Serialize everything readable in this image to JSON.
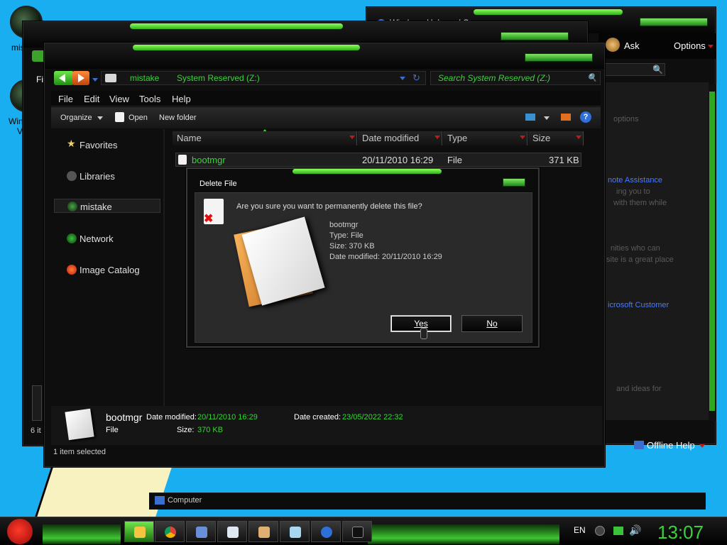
{
  "desktop": {
    "icons": [
      {
        "label": "mis"
      },
      {
        "label": "Win"
      },
      {
        "label": "V"
      }
    ]
  },
  "help_window": {
    "title": "Windows Help and Support",
    "ask_label": "Ask",
    "options_label": "Options",
    "text_lines": [
      "options",
      "note Assistance",
      "ing you to",
      "with them while",
      "nities who can",
      "site is a great place",
      "icrosoft Customer",
      "and ideas for"
    ],
    "offline_help_label": "Offline Help",
    "status_label": "Computer"
  },
  "explorer": {
    "back_window_label": "Fi",
    "back_status_label": "6 it",
    "breadcrumb": {
      "part1": "mistake",
      "part2": "System Reserved (Z:)"
    },
    "search_placeholder": "Search System Reserved (Z:)",
    "menu": {
      "file": "File",
      "edit": "Edit",
      "view": "View",
      "tools": "Tools",
      "help": "Help"
    },
    "toolbar": {
      "organize": "Organize",
      "open": "Open",
      "new_folder": "New folder"
    },
    "nav": {
      "favorites": "Favorites",
      "libraries": "Libraries",
      "mistake": "mistake",
      "network": "Network",
      "image_catalog": "Image Catalog"
    },
    "columns": {
      "name": "Name",
      "date_modified": "Date modified",
      "type": "Type",
      "size": "Size"
    },
    "file": {
      "name": "bootmgr",
      "date": "20/11/2010 16:29",
      "type": "File",
      "size": "371 KB"
    },
    "details": {
      "name": "bootmgr",
      "type": "File",
      "date_modified_label": "Date modified:",
      "date_modified": "20/11/2010 16:29",
      "size_label": "Size:",
      "size": "370 KB",
      "date_created_label": "Date created:",
      "date_created": "23/05/2022 22:32"
    },
    "status": "1 item selected"
  },
  "dialog": {
    "title": "Delete File",
    "question": "Are you sure you want to permanently delete this file?",
    "file_name": "bootmgr",
    "file_type": "Type: File",
    "file_size": "Size: 370 KB",
    "file_date": "Date modified: 20/11/2010 16:29",
    "yes_label": "Yes",
    "no_label": "No"
  },
  "taskbar": {
    "language": "EN",
    "clock": "13:07"
  },
  "colors": {
    "accent_green": "#39d339",
    "desktop_blue": "#19aef0",
    "arrow_red": "#c21a1a"
  }
}
